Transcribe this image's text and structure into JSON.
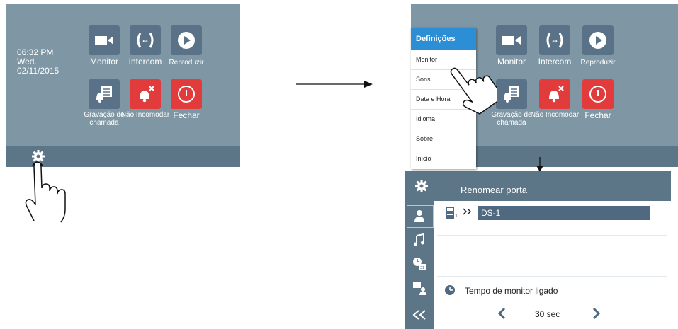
{
  "screen1": {
    "time": "06:32 PM",
    "day": "Wed.",
    "date": "02/11/2015",
    "apps": [
      {
        "label": "Monitor",
        "icon": "camera-icon"
      },
      {
        "label": "Intercom",
        "icon": "intercom-icon"
      },
      {
        "label": "Reproduzir",
        "icon": "play-icon"
      },
      {
        "label": "Gravação de chamada",
        "icon": "call-record-icon"
      },
      {
        "label": "Não Incomodar",
        "icon": "do-not-disturb-icon"
      },
      {
        "label": "Fechar",
        "icon": "power-icon"
      }
    ]
  },
  "screen2": {
    "apps": [
      {
        "label": "Monitor"
      },
      {
        "label": "Intercom"
      },
      {
        "label": "Reproduzir"
      },
      {
        "label": "Gravação de chamada"
      },
      {
        "label": "Não Incomodar"
      },
      {
        "label": "Fechar"
      }
    ],
    "menu": {
      "title": "Definições",
      "items": [
        "Monitor",
        "Sons",
        "Data e Hora",
        "Idioma",
        "Sobre",
        "Início"
      ]
    }
  },
  "screen3": {
    "title": "Renomear porta",
    "door_index": "1",
    "door_name": "DS-1",
    "monitor_time_label": "Tempo de monitor ligado",
    "monitor_time_value": "30 sec"
  },
  "colors": {
    "screen_bg": "#7f97a5",
    "bar_bg": "#5c7587",
    "tile_bg": "#5a7287",
    "alert_red": "#e23b3b",
    "menu_accent": "#2c8fd6"
  }
}
